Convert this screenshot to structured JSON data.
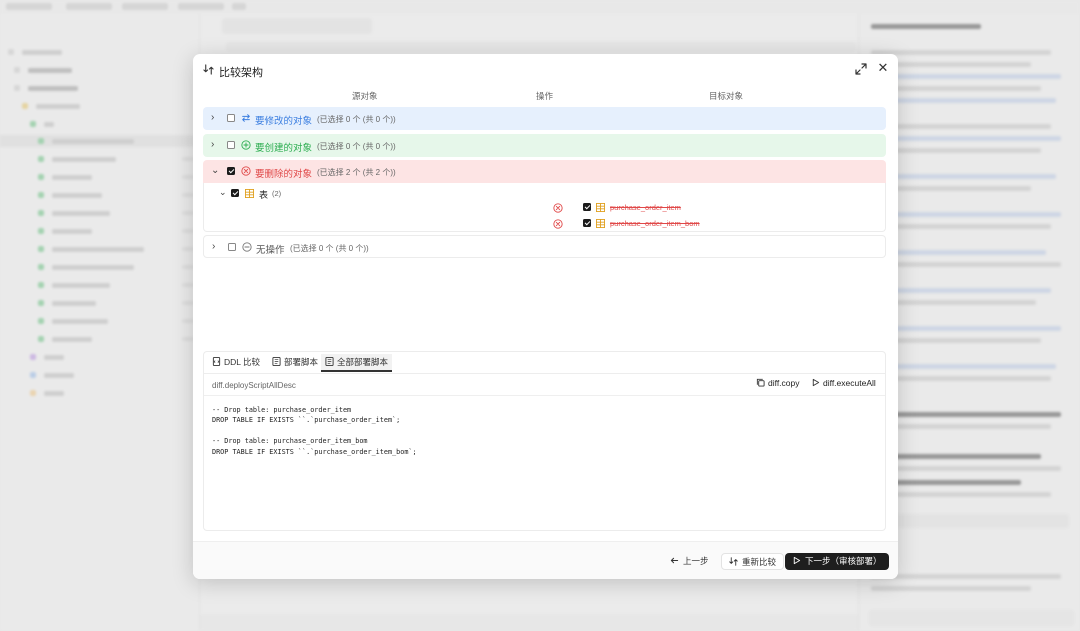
{
  "modal": {
    "title": "比较架构",
    "columns": {
      "source": "源对象",
      "operation": "操作",
      "target": "目标对象"
    },
    "groups": {
      "modify": {
        "label": "要修改的对象",
        "count": "(已选择 0 个 (共 0 个))",
        "checked": false,
        "color": "#3b7ee0",
        "bg": "#e6f0fd"
      },
      "create": {
        "label": "要创建的对象",
        "count": "(已选择 0 个 (共 0 个))",
        "checked": false,
        "color": "#2eae52",
        "bg": "#e6f7ea"
      },
      "delete": {
        "label": "要删除的对象",
        "count": "(已选择 2 个 (共 2 个))",
        "checked": true,
        "color": "#e04848",
        "bg": "#fde4e4",
        "subgroup": {
          "label": "表",
          "count": "(2)",
          "checked": true
        },
        "items": [
          {
            "name": "purchase_order_item",
            "checked": true,
            "icon": "table-icon",
            "op_icon": "delete-circle-icon"
          },
          {
            "name": "purchase_order_item_bom",
            "checked": true,
            "icon": "table-icon",
            "op_icon": "delete-circle-icon"
          }
        ]
      },
      "none": {
        "label": "无操作",
        "count": "(已选择 0 个 (共 0 个))",
        "checked": false,
        "color": "#555555",
        "bg": "#ffffff"
      }
    },
    "tabs": [
      "DDL 比较",
      "部署脚本",
      "全部部署脚本"
    ],
    "active_tab": "全部部署脚本",
    "script_desc": "diff.deployScriptAllDesc",
    "actions": {
      "copy": "diff.copy",
      "execute_all": "diff.executeAll"
    },
    "code_lines": [
      "-- Drop table: purchase_order_item",
      "DROP TABLE IF EXISTS ``.`purchase_order_item`;",
      "",
      "-- Drop table: purchase_order_item_bom",
      "DROP TABLE IF EXISTS ``.`purchase_order_item_bom`;"
    ],
    "footer": {
      "prev": "上一步",
      "recompare": "重新比较",
      "next": "下一步（审核部署）"
    }
  }
}
